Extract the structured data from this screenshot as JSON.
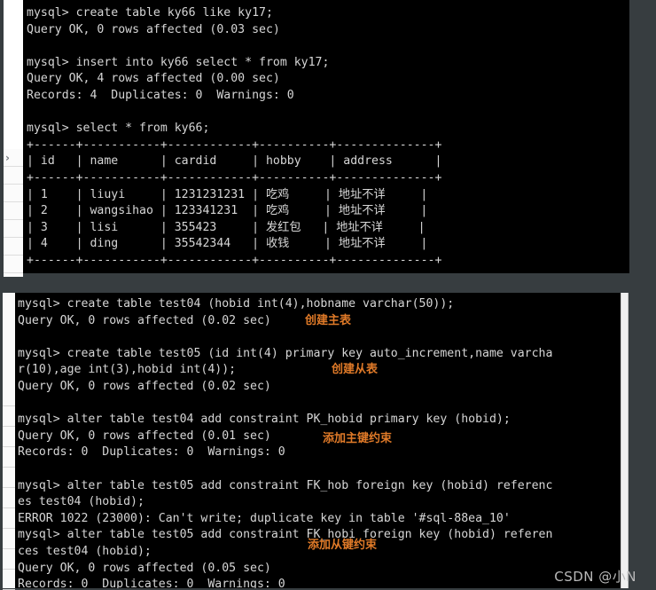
{
  "theme": {
    "page_background": "#373d40",
    "terminal_background": "#000000",
    "terminal_text": "#d6d6d6",
    "annotation_color": "#e07a28",
    "watermark_color": "#b9b9b9",
    "rail_background": "#ffffff",
    "scrollbar_color": "#efefef"
  },
  "panel1": {
    "name": "mysql-terminal-top",
    "chevron_icon": "›",
    "lines": [
      "mysql> create table ky66 like ky17;",
      "Query OK, 0 rows affected (0.03 sec)",
      "",
      "mysql> insert into ky66 select * from ky17;",
      "Query OK, 4 rows affected (0.00 sec)",
      "Records: 4  Duplicates: 0  Warnings: 0",
      "",
      "mysql> select * from ky66;",
      "+------+-----------+------------+----------+--------------+",
      "| id   | name      | cardid     | hobby    | address      |",
      "+------+-----------+------------+----------+--------------+",
      "| 1    | liuyi     | 1231231231 | 吃鸡     | 地址不详     |",
      "| 2    | wangsihao | 123341231  | 吃鸡     | 地址不详     |",
      "| 3    | lisi      | 355423     | 发红包   | 地址不详     |",
      "| 4    | ding      | 35542344   | 收钱     | 地址不详     |",
      "+------+-----------+------------+----------+--------------+"
    ],
    "result_table": {
      "columns": [
        "id",
        "name",
        "cardid",
        "hobby",
        "address"
      ],
      "rows": [
        [
          "1",
          "liuyi",
          "1231231231",
          "吃鸡",
          "地址不详"
        ],
        [
          "2",
          "wangsihao",
          "123341231",
          "吃鸡",
          "地址不详"
        ],
        [
          "3",
          "lisi",
          "355423",
          "发红包",
          "地址不详"
        ],
        [
          "4",
          "ding",
          "35542344",
          "收钱",
          "地址不详"
        ]
      ]
    }
  },
  "panel2": {
    "name": "mysql-terminal-bottom",
    "lines": [
      "mysql> create table test04 (hobid int(4),hobname varchar(50));",
      "Query OK, 0 rows affected (0.02 sec)",
      "",
      "mysql> create table test05 (id int(4) primary key auto_increment,name varcha",
      "r(10),age int(3),hobid int(4));",
      "Query OK, 0 rows affected (0.02 sec)",
      "",
      "mysql> alter table test04 add constraint PK_hobid primary key (hobid);",
      "Query OK, 0 rows affected (0.01 sec)",
      "Records: 0  Duplicates: 0  Warnings: 0",
      "",
      "mysql> alter table test05 add constraint FK_hob foreign key (hobid) referenc",
      "es test04 (hobid);",
      "ERROR 1022 (23000): Can't write; duplicate key in table '#sql-88ea_10'",
      "mysql> alter table test05 add constraint FK_hobi foreign key (hobid) referen",
      "ces test04 (hobid);",
      "Query OK, 0 rows affected (0.05 sec)",
      "Records: 0  Duplicates: 0  Warnings: 0"
    ]
  },
  "annotations": [
    {
      "id": "annot-1",
      "text": "创建主表"
    },
    {
      "id": "annot-2",
      "text": "创建从表"
    },
    {
      "id": "annot-3",
      "text": "添加主键约束"
    },
    {
      "id": "annot-4",
      "text": "添加从键约束"
    }
  ],
  "watermark": {
    "text": "CSDN @小N"
  }
}
